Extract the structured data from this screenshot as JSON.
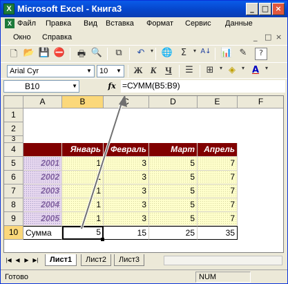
{
  "window": {
    "title": "Microsoft Excel - Книга3",
    "controls": {
      "minimize": "_",
      "maximize": "□",
      "close": "×"
    }
  },
  "menu": {
    "items": [
      "Файл",
      "Правка",
      "Вид",
      "Вставка",
      "Формат",
      "Сервис",
      "Данные"
    ],
    "items2": [
      "Окно",
      "Справка"
    ],
    "doc_controls": [
      "_",
      "□",
      "×"
    ]
  },
  "toolbar_standard": {
    "icons": [
      "new-icon",
      "open-icon",
      "save-icon",
      "permission-icon",
      "print-icon",
      "print-preview-icon",
      "copy-icon",
      "undo-icon",
      "hyperlink-icon",
      "autosum-icon",
      "sort-asc-icon",
      "chart-wizard-icon",
      "drawing-icon",
      "help-icon"
    ]
  },
  "toolbar_format": {
    "font": "Arial Cyr",
    "size": "10",
    "bold": "Ж",
    "italic": "К",
    "underline": "Ч"
  },
  "formula_bar": {
    "name_box": "B10",
    "fx": "fx",
    "formula": "=СУММ(B5:B9)"
  },
  "grid": {
    "columns": [
      "A",
      "B",
      "C",
      "D",
      "E",
      "F"
    ],
    "rows": [
      "1",
      "2",
      "3",
      "4",
      "5",
      "6",
      "7",
      "8",
      "9",
      "10"
    ],
    "header_row": [
      "",
      "Январь",
      "Февраль",
      "Март",
      "Апрель"
    ],
    "data": [
      {
        "year": "2001",
        "values": [
          "1",
          "3",
          "5",
          "7"
        ]
      },
      {
        "year": "2002",
        "values": [
          "1",
          "3",
          "5",
          "7"
        ]
      },
      {
        "year": "2003",
        "values": [
          "1",
          "3",
          "5",
          "7"
        ]
      },
      {
        "year": "2004",
        "values": [
          "1",
          "3",
          "5",
          "7"
        ]
      },
      {
        "year": "2005",
        "values": [
          "1",
          "3",
          "5",
          "7"
        ]
      }
    ],
    "total_label": "Сумма",
    "totals": [
      "5",
      "15",
      "25",
      "35"
    ],
    "active_cell": "B10",
    "colors": {
      "header_bg": "#800000",
      "data_bg": "#ffffcc",
      "year_bg": "#e8d8f0"
    }
  },
  "sheets": {
    "tabs": [
      "Лист1",
      "Лист2",
      "Лист3"
    ],
    "active": "Лист1"
  },
  "status": {
    "text": "Готово",
    "num": "NUM"
  }
}
